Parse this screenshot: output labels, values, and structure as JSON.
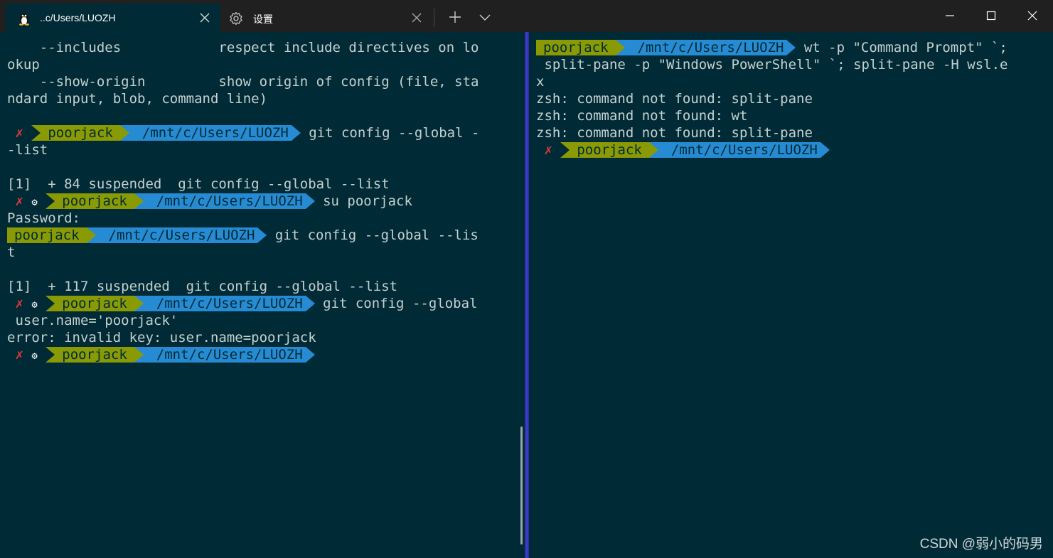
{
  "titlebar": {
    "tabs": [
      {
        "title": "..c/Users/LUOZH",
        "icon": "linux-penguin-icon",
        "active": true
      },
      {
        "title": "设置",
        "icon": "gear-icon",
        "active": false
      }
    ],
    "new_tab_icon": "plus-icon",
    "dropdown_icon": "chevron-down-icon",
    "window_controls": [
      "minimize-icon",
      "maximize-icon",
      "close-icon"
    ]
  },
  "colors": {
    "background": "#002b36",
    "user_segment": "#8a9a05",
    "path_segment": "#268bd2",
    "error_mark": "#e3393a",
    "text": "#c5d0cf",
    "pane_divider": "#3c3cd8"
  },
  "left_pane": {
    "lines": [
      {
        "type": "text",
        "text": "    --includes            respect include directives on lo"
      },
      {
        "type": "text",
        "text": "okup"
      },
      {
        "type": "text",
        "text": "    --show-origin         show origin of config (file, sta"
      },
      {
        "type": "text",
        "text": "ndard input, blob, command line)"
      },
      {
        "type": "text",
        "text": ""
      },
      {
        "type": "prompt",
        "mark": "✗",
        "gear": "",
        "user": "poorjack",
        "path": "/mnt/c/Users/LUOZH",
        "cmd": "git config --global -"
      },
      {
        "type": "text",
        "text": "-list"
      },
      {
        "type": "text",
        "text": ""
      },
      {
        "type": "text",
        "text": "[1]  + 84 suspended  git config --global --list"
      },
      {
        "type": "prompt",
        "mark": "✗",
        "gear": "⚙",
        "user": "poorjack",
        "path": "/mnt/c/Users/LUOZH",
        "cmd": "su poorjack"
      },
      {
        "type": "text",
        "text": "Password:"
      },
      {
        "type": "prompt",
        "mark": "",
        "gear": "",
        "user": "poorjack",
        "path": "/mnt/c/Users/LUOZH",
        "cmd": "git config --global --lis"
      },
      {
        "type": "text",
        "text": "t"
      },
      {
        "type": "text",
        "text": ""
      },
      {
        "type": "text",
        "text": "[1]  + 117 suspended  git config --global --list"
      },
      {
        "type": "prompt",
        "mark": "✗",
        "gear": "⚙",
        "user": "poorjack",
        "path": "/mnt/c/Users/LUOZH",
        "cmd": "git config --global"
      },
      {
        "type": "text",
        "text": " user.name='poorjack'"
      },
      {
        "type": "text",
        "text": "error: invalid key: user.name=poorjack"
      },
      {
        "type": "prompt",
        "mark": "✗",
        "gear": "⚙",
        "user": "poorjack",
        "path": "/mnt/c/Users/LUOZH",
        "cmd": ""
      }
    ]
  },
  "right_pane": {
    "lines": [
      {
        "type": "prompt",
        "mark": "",
        "gear": "",
        "user": "poorjack",
        "path": "/mnt/c/Users/LUOZH",
        "cmd": "wt -p \"Command Prompt\" `;"
      },
      {
        "type": "text",
        "text": " split-pane -p \"Windows PowerShell\" `; split-pane -H wsl.e"
      },
      {
        "type": "text",
        "text": "x"
      },
      {
        "type": "text",
        "text": "zsh: command not found: split-pane"
      },
      {
        "type": "text",
        "text": "zsh: command not found: wt"
      },
      {
        "type": "text",
        "text": "zsh: command not found: split-pane"
      },
      {
        "type": "prompt",
        "mark": "✗",
        "gear": "",
        "user": "poorjack",
        "path": "/mnt/c/Users/LUOZH",
        "cmd": ""
      }
    ]
  },
  "watermark": "CSDN @弱小的码男"
}
